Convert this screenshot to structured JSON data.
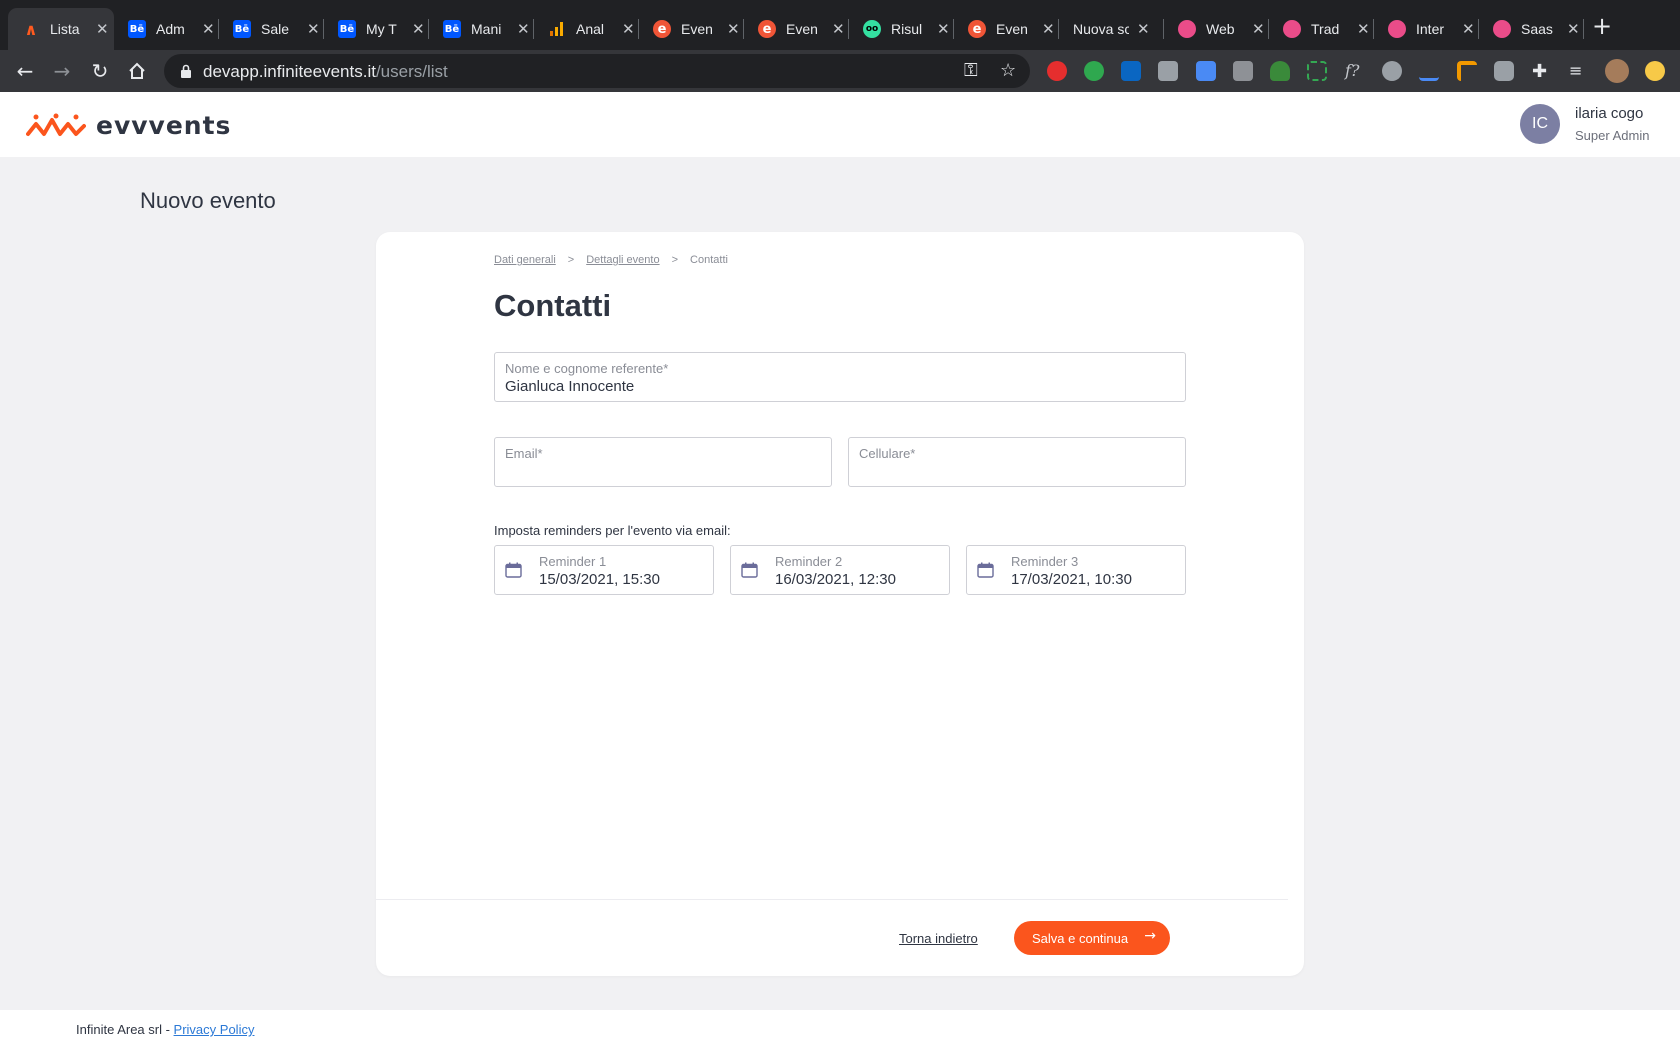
{
  "browser": {
    "tabs": [
      {
        "title": "Lista",
        "icon": "evvvents-icon",
        "color": "#ff5a1f",
        "glyph": "∧",
        "active": true
      },
      {
        "title": "Adm",
        "icon": "behance-icon",
        "color": "#0057ff",
        "glyph": "Bē",
        "active": false
      },
      {
        "title": "Sale",
        "icon": "behance-icon",
        "color": "#0057ff",
        "glyph": "Bē",
        "active": false
      },
      {
        "title": "My T",
        "icon": "behance-icon",
        "color": "#0057ff",
        "glyph": "Bē",
        "active": false
      },
      {
        "title": "Mani",
        "icon": "behance-icon",
        "color": "#0057ff",
        "glyph": "Bē",
        "active": false
      },
      {
        "title": "Anal",
        "icon": "analytics-icon",
        "color": "#f9ab00",
        "glyph": "▮",
        "active": false
      },
      {
        "title": "Even",
        "icon": "eventbrite-icon",
        "color": "#f05537",
        "glyph": "e",
        "active": false
      },
      {
        "title": "Even",
        "icon": "eventbrite-icon",
        "color": "#f05537",
        "glyph": "e",
        "active": false
      },
      {
        "title": "Risul",
        "icon": "tripadvisor-icon",
        "color": "#34e0a1",
        "glyph": "oo",
        "active": false
      },
      {
        "title": "Even",
        "icon": "eventbrite-icon",
        "color": "#f05537",
        "glyph": "e",
        "active": false
      },
      {
        "title": "Nuova sc",
        "icon": "",
        "color": "",
        "glyph": "",
        "active": false
      },
      {
        "title": "Web",
        "icon": "dribbble-icon",
        "color": "#ea4c89",
        "glyph": "◍",
        "active": false
      },
      {
        "title": "Trad",
        "icon": "dribbble-icon",
        "color": "#ea4c89",
        "glyph": "◍",
        "active": false
      },
      {
        "title": "Inter",
        "icon": "dribbble-icon",
        "color": "#ea4c89",
        "glyph": "◍",
        "active": false
      },
      {
        "title": "Saas",
        "icon": "dribbble-icon",
        "color": "#ea4c89",
        "glyph": "◍",
        "active": false
      }
    ],
    "url_host": "devapp.infiniteevents.it",
    "url_path": "/users/list"
  },
  "app": {
    "logo_text": "evvvents",
    "brand_color": "#fb551d",
    "user": {
      "initials": "IC",
      "name": "ilaria cogo",
      "role": "Super Admin"
    }
  },
  "page": {
    "title": "Nuovo evento",
    "breadcrumb": {
      "step1": "Dati generali",
      "sep": ">",
      "step2": "Dettagli evento",
      "step3": "Contatti"
    },
    "heading": "Contatti",
    "form": {
      "name_label": "Nome e cognome referente*",
      "name_value": "Gianluca Innocente",
      "email_label": "Email*",
      "email_value": "",
      "phone_label": "Cellulare*",
      "phone_value": "",
      "reminders_caption": "Imposta reminders per l'evento via email:",
      "reminders": [
        {
          "label": "Reminder 1",
          "value": "15/03/2021, 15:30"
        },
        {
          "label": "Reminder 2",
          "value": "16/03/2021, 12:30"
        },
        {
          "label": "Reminder 3",
          "value": "17/03/2021, 10:30"
        }
      ]
    },
    "actions": {
      "back": "Torna indietro",
      "save": "Salva e continua",
      "save_icon": "arrow-right-icon"
    }
  },
  "footer": {
    "company": "Infinite Area srl - ",
    "privacy": "Privacy Policy"
  }
}
